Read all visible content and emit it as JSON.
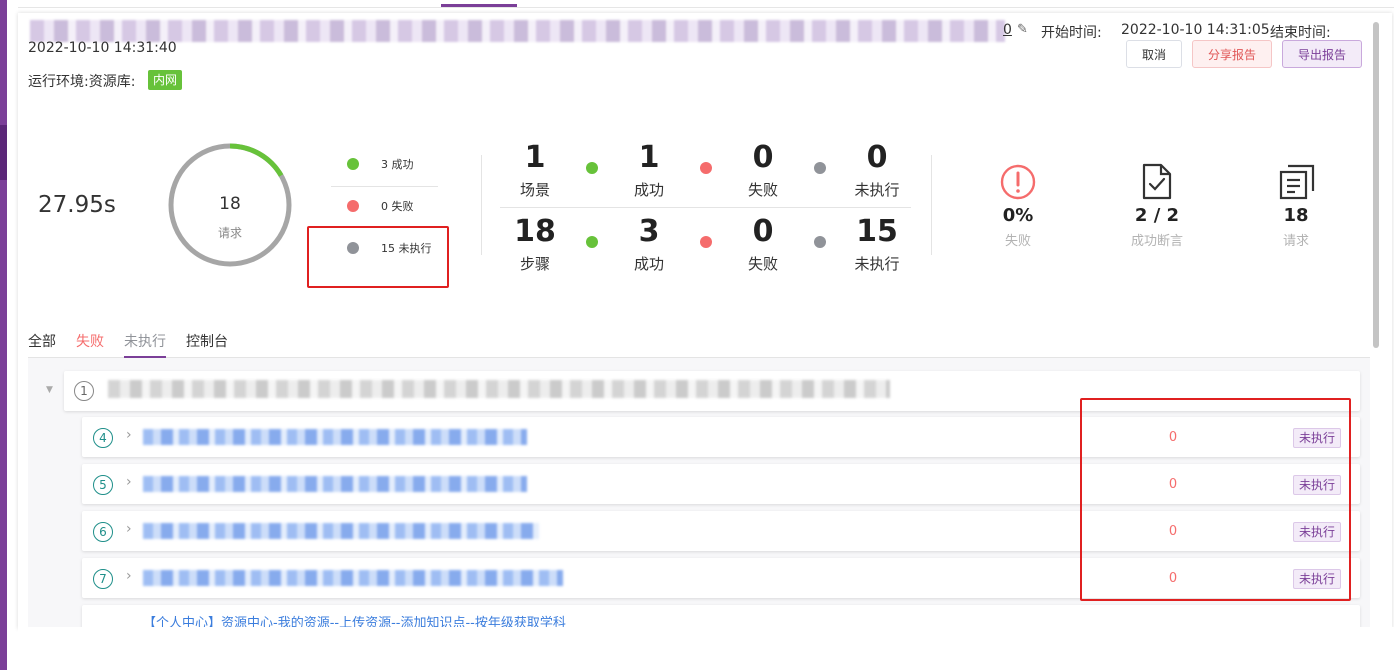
{
  "header": {
    "edit_count": "0",
    "start_label": "开始时间:",
    "start_time": "2022-10-10 14:31:05",
    "end_label": "结束时间:",
    "end_time": "2022-10-10 14:31:40",
    "buttons": {
      "cancel": "取消",
      "share": "分享报告",
      "export": "导出报告"
    },
    "env_label": "运行环境:资源库:",
    "env_tag": "内网"
  },
  "summary": {
    "duration": "27.95s",
    "ring": {
      "total": "18",
      "label": "请求",
      "success_fraction": 0.1667
    },
    "legend": [
      {
        "label": "3 成功",
        "color": "#67c23a"
      },
      {
        "label": "0 失败",
        "color": "#f56c6c"
      },
      {
        "label": "15 未执行",
        "color": "#909399"
      }
    ],
    "scenes": {
      "total": "1",
      "total_label": "场景",
      "success": "1",
      "success_label": "成功",
      "fail": "0",
      "fail_label": "失败",
      "skip": "0",
      "skip_label": "未执行"
    },
    "steps": {
      "total": "18",
      "total_label": "步骤",
      "success": "3",
      "success_label": "成功",
      "fail": "0",
      "fail_label": "失败",
      "skip": "15",
      "skip_label": "未执行"
    },
    "kpis": [
      {
        "value": "0%",
        "label": "失败",
        "icon": "warning-circle-icon"
      },
      {
        "value": "2 / 2",
        "label": "成功断言",
        "icon": "check-document-icon"
      },
      {
        "value": "18",
        "label": "请求",
        "icon": "copy-document-icon"
      }
    ]
  },
  "tabs": [
    "全部",
    "失败",
    "未执行",
    "控制台"
  ],
  "tree": {
    "root": {
      "index": "1"
    },
    "rows": [
      {
        "index": "4",
        "count": "0",
        "status": "未执行"
      },
      {
        "index": "5",
        "count": "0",
        "status": "未执行"
      },
      {
        "index": "6",
        "count": "0",
        "status": "未执行"
      },
      {
        "index": "7",
        "count": "0",
        "status": "未执行"
      }
    ],
    "last_row_text": "【个人中心】资源中心-我的资源--上传资源--添加知识点--按年级获取学科"
  },
  "colors": {
    "accent": "#7b3f98",
    "success": "#67c23a",
    "fail": "#f56c6c",
    "skip": "#909399",
    "annotation": "#e02020"
  }
}
